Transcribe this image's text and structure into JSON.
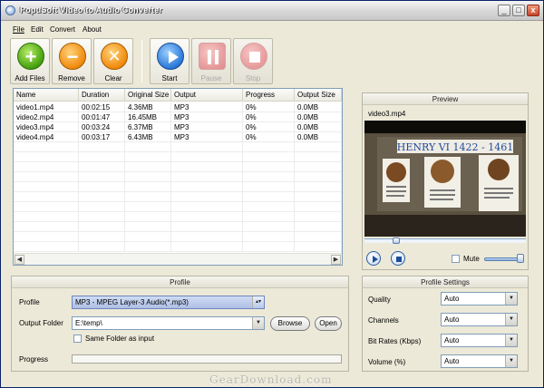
{
  "window": {
    "title": "PopuSoft Video to Audio Converter",
    "minimize": "_",
    "maximize": "□",
    "close": "x"
  },
  "menu": [
    "File",
    "Edit",
    "Convert",
    "About"
  ],
  "toolbar": {
    "add_files": "Add Files",
    "remove": "Remove",
    "clear": "Clear",
    "start": "Start",
    "pause": "Pause",
    "stop": "Stop",
    "icons": {
      "add_files": "plus-icon",
      "remove": "minus-icon",
      "clear": "x-icon",
      "start": "play-icon",
      "pause": "pause-icon",
      "stop": "stop-icon"
    },
    "disabled": [
      "pause",
      "stop"
    ]
  },
  "filelist": {
    "columns": [
      "Name",
      "Duration",
      "Original Size",
      "Output",
      "Progress",
      "Output Size"
    ],
    "rows": [
      [
        "video1.mp4",
        "00:02:15",
        "4.36MB",
        "MP3",
        "0%",
        "0.0MB"
      ],
      [
        "video2.mp4",
        "00:01:47",
        "16.45MB",
        "MP3",
        "0%",
        "0.0MB"
      ],
      [
        "video3.mp4",
        "00:03:24",
        "6.37MB",
        "MP3",
        "0%",
        "0.0MB"
      ],
      [
        "video4.mp4",
        "00:03:17",
        "6.43MB",
        "MP3",
        "0%",
        "0.0MB"
      ]
    ]
  },
  "preview": {
    "title": "Preview",
    "file": "video3.mp4",
    "frame_text": {
      "heading": "HENRY VI 1422 - 1461"
    },
    "mute_label": "Mute",
    "mute_checked": false,
    "seek_position": 0.18,
    "volume_level": 0.9
  },
  "profile": {
    "title": "Profile",
    "profile_label": "Profile",
    "profile_value": "MP3 - MPEG Layer-3 Audio(*.mp3)",
    "output_folder_label": "Output Folder",
    "output_folder_value": "E:\\temp\\",
    "browse": "Browse",
    "open": "Open",
    "same_folder_label": "Same Folder as input",
    "same_folder_checked": false,
    "progress_label": "Progress",
    "progress_value": 0
  },
  "profile_settings": {
    "title": "Profile Settings",
    "fields": [
      {
        "label": "Quality",
        "value": "Auto"
      },
      {
        "label": "Channels",
        "value": "Auto"
      },
      {
        "label": "Bit Rates (Kbps)",
        "value": "Auto"
      },
      {
        "label": "Volume (%)",
        "value": "Auto"
      }
    ]
  },
  "watermark": "GearDownload.com"
}
